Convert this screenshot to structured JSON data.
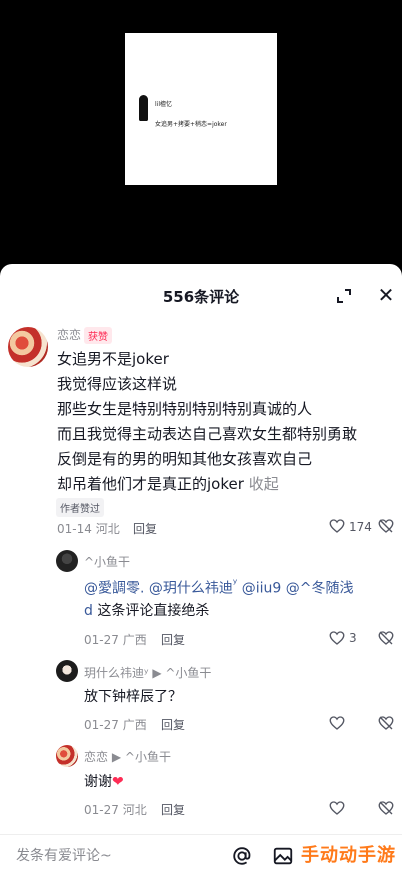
{
  "video": {
    "frame_name": "lil檀忆",
    "frame_caption": "女追男+拷要+稍恋=joker"
  },
  "sheet": {
    "title": "556条评论"
  },
  "comment": {
    "user": "恋恋",
    "tag": "获赞",
    "lines": [
      "女追男不是joker",
      "我觉得应该这样说",
      "那些女生是特别特别特别特别真诚的人",
      "而且我觉得主动表达自己喜欢女生都特别勇敢",
      "反倒是有的男的明知其他女孩喜欢自己"
    ],
    "last_line": "却吊着他们才是真正的joker",
    "collapse": "收起",
    "badge": "作者赞过",
    "date": "01-14",
    "location": "河北",
    "reply": "回复",
    "likes": "174"
  },
  "replies": [
    {
      "user": "^小鱼干",
      "mention1": "@愛調零. @玥什么祎迪",
      "mention1b": "ʸ",
      "mention1c": " @iiu9 @^冬随浅",
      "line2a": "d",
      "line2b": " 这条评论直接绝杀",
      "date": "01-27",
      "location": "广西",
      "reply": "回复",
      "likes": "3"
    },
    {
      "user": "玥什么祎迪ʸ",
      "arrow": "▶",
      "target": "^小鱼干",
      "text": "放下钟梓辰了？",
      "date": "01-27",
      "location": "广西",
      "reply": "回复"
    },
    {
      "user": "恋恋",
      "arrow": "▶",
      "target": "^小鱼干",
      "text": "谢谢",
      "emoji": "❤",
      "date": "01-27",
      "location": "河北",
      "reply": "回复"
    }
  ],
  "input": {
    "placeholder": "发条有爱评论~",
    "watermark": "手动动手游"
  },
  "colors": {
    "accent": "#fe2c55",
    "mention": "#385899"
  }
}
